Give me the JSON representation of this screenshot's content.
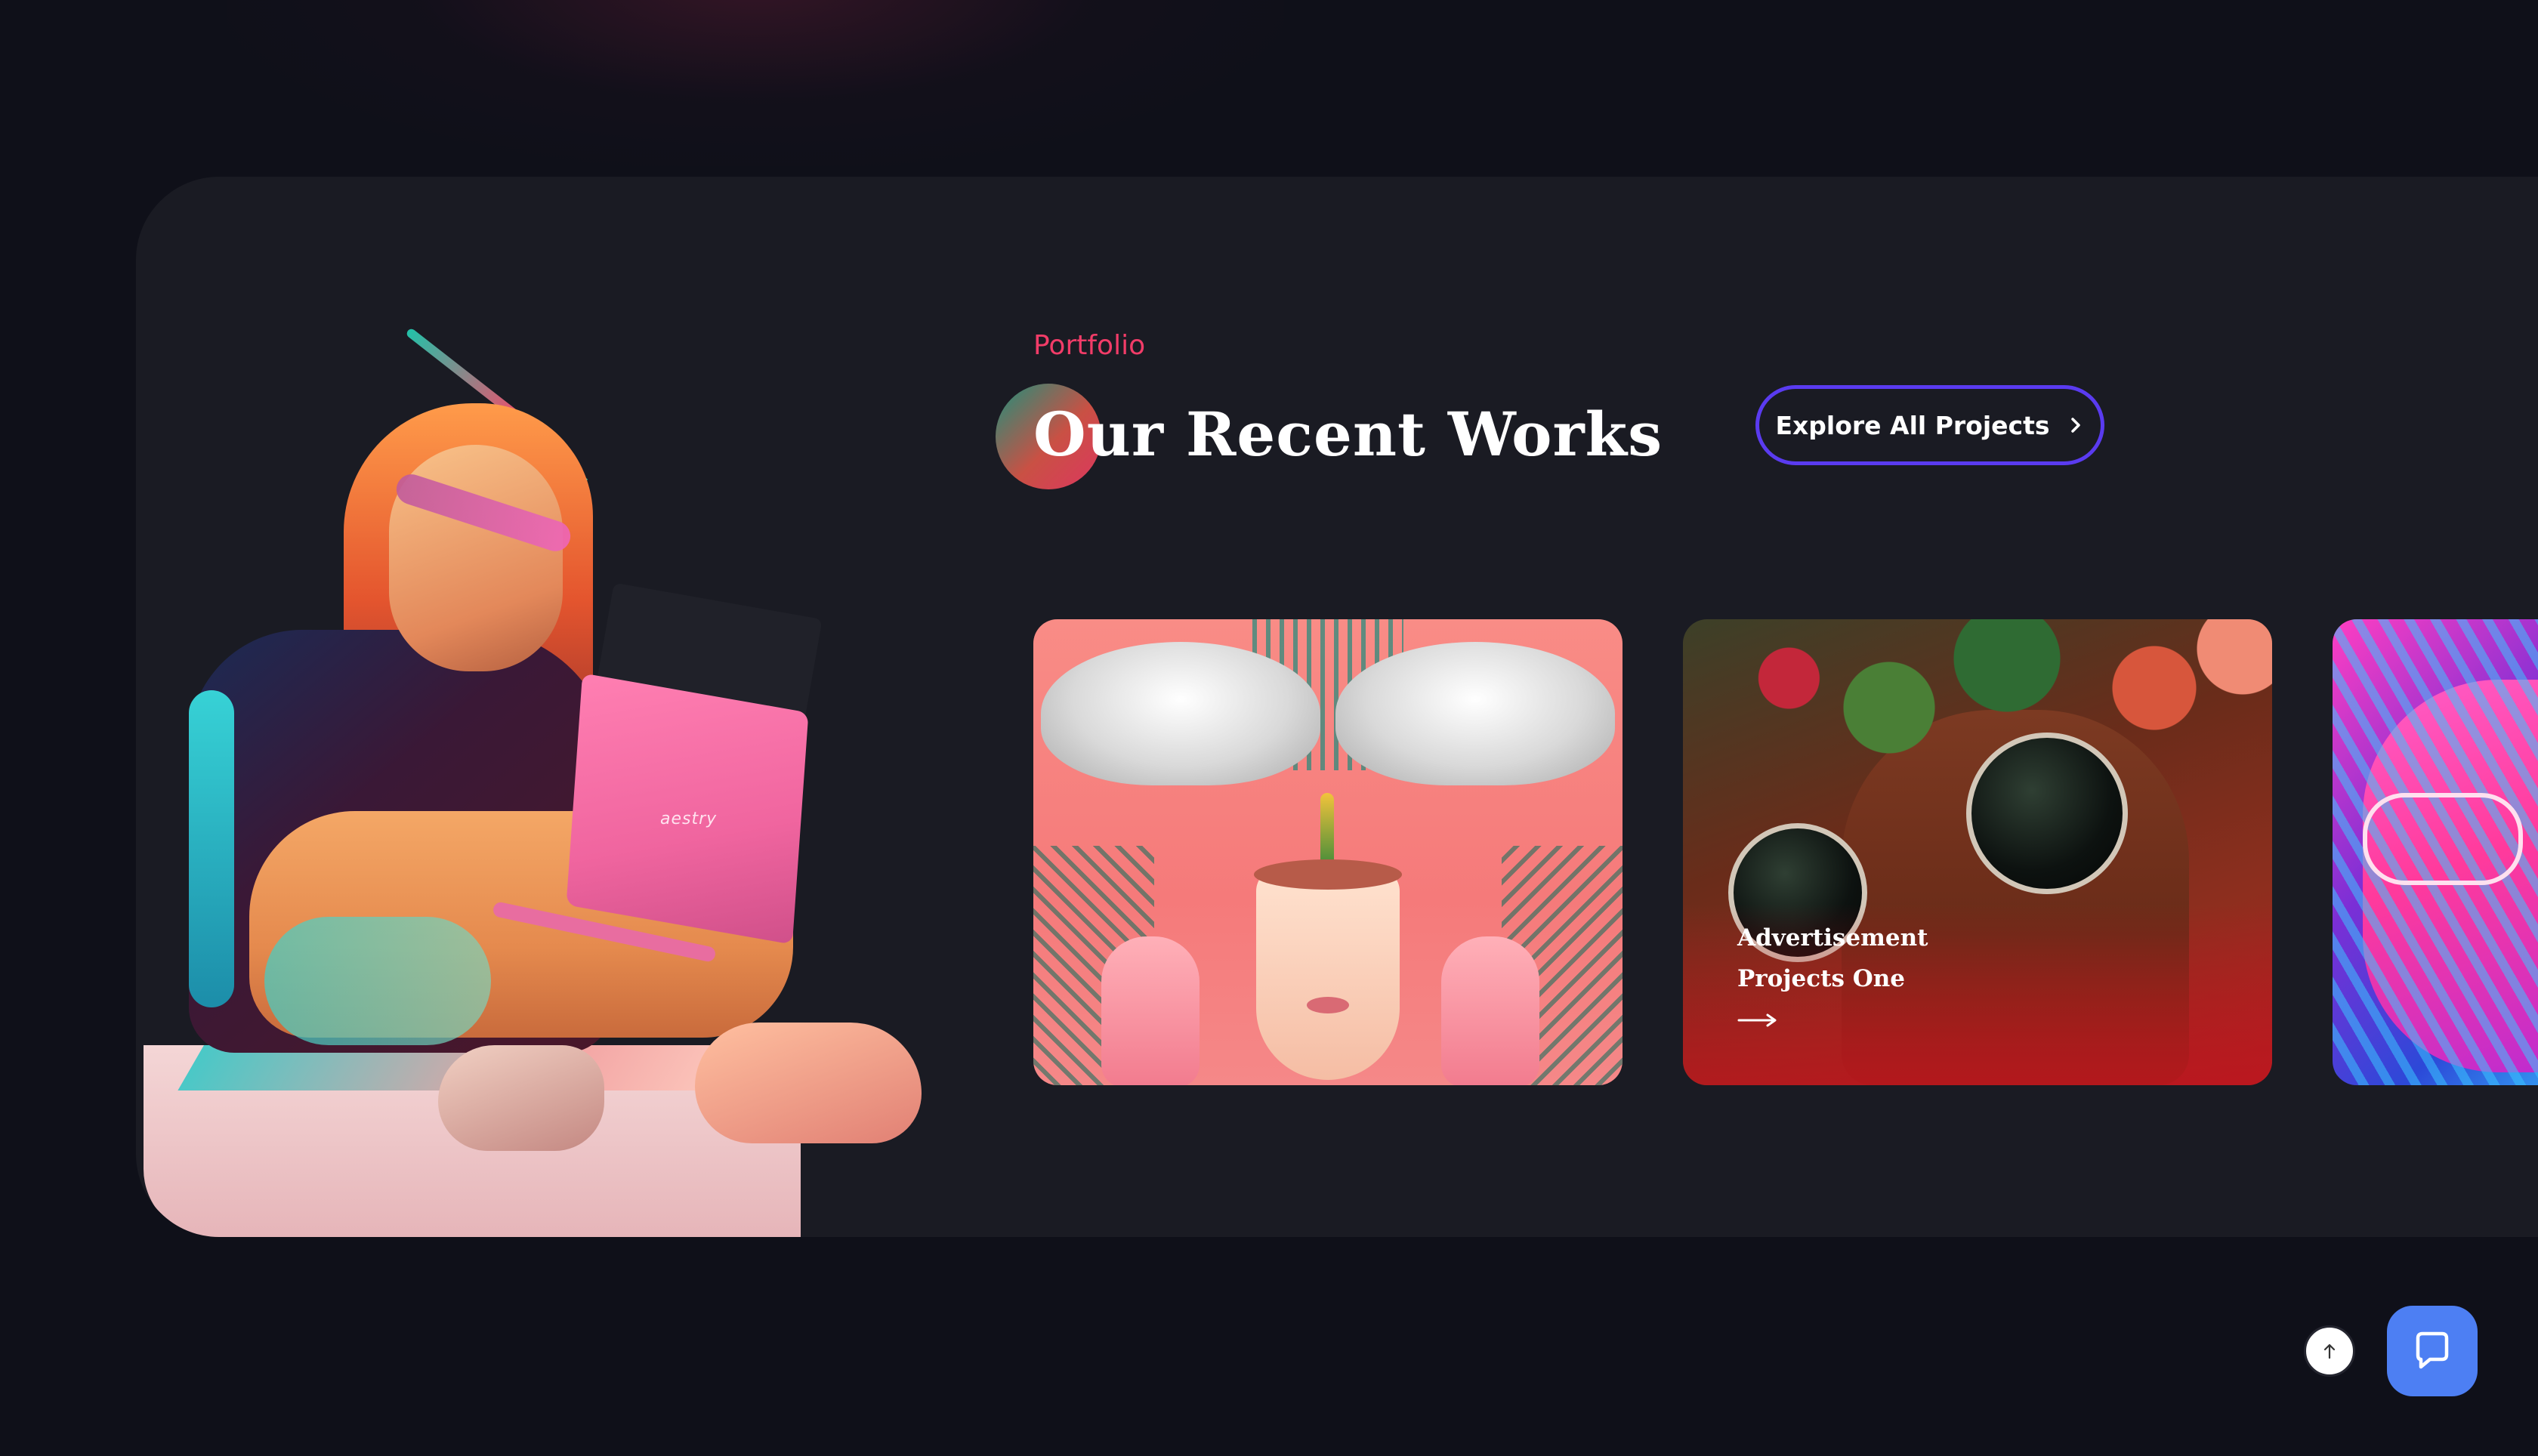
{
  "section": {
    "eyebrow": "Portfolio",
    "title": "Our Recent Works",
    "explore_button": "Explore All Projects"
  },
  "hero": {
    "laptop_brand": "aestry"
  },
  "cards": [
    {
      "title": ""
    },
    {
      "title": "Advertisement Projects One"
    },
    {
      "title": ""
    }
  ],
  "colors": {
    "background": "#0f1019",
    "panel": "#1a1b23",
    "accent_pink": "#f23c68",
    "button_border": "#5a3bf0",
    "chat_button": "#4d7ff3"
  },
  "icons": {
    "explore_button": "chevron-right-icon",
    "scroll_top": "arrow-up-icon",
    "chat": "chat-bubble-icon",
    "card_link": "arrow-right-icon"
  }
}
